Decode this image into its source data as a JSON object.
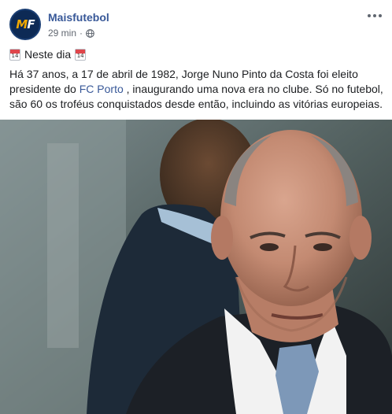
{
  "post": {
    "page_name": "Maisfutebol",
    "avatar_text": "MF",
    "time": "29 min",
    "separator": "·",
    "audience_icon": "globe-icon",
    "more_icon": "more-options-icon",
    "heading_icon": "calendar-icon",
    "calendar_day": "14",
    "heading": "Neste dia",
    "text_part1": "Há 37 anos, a 17 de abril de 1982, Jorge Nuno Pinto da Costa foi eleito presidente do ",
    "link_text": "FC Porto",
    "text_part2": " , inaugurando uma nova era no clube. Só no futebol, são 60 os troféus conquistados desde então, incluindo as vitórias europeias."
  },
  "colors": {
    "link": "#385898",
    "meta": "#616770",
    "text": "#1c1e21"
  }
}
